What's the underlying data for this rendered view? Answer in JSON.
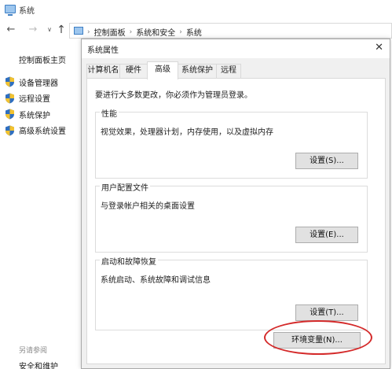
{
  "window": {
    "title": "系统"
  },
  "address": {
    "breadcrumbs": [
      "控制面板",
      "系统和安全",
      "系统"
    ]
  },
  "left_pane": {
    "home_link": "控制面板主页",
    "items": [
      {
        "label": "设备管理器",
        "icon": "shield-icon"
      },
      {
        "label": "远程设置",
        "icon": "shield-icon"
      },
      {
        "label": "系统保护",
        "icon": "shield-icon"
      },
      {
        "label": "高级系统设置",
        "icon": "shield-icon"
      }
    ],
    "see_also": "另请参阅",
    "security_link": "安全和维护"
  },
  "dialog": {
    "title": "系统属性",
    "close_glyph": "✕",
    "tabs": [
      "计算机名",
      "硬件",
      "高级",
      "系统保护",
      "远程"
    ],
    "active_tab": "高级",
    "admin_note": "要进行大多数更改，你必须作为管理员登录。",
    "groups": [
      {
        "title": "性能",
        "description": "视觉效果，处理器计划，内存使用，以及虚拟内存",
        "button": "设置(S)..."
      },
      {
        "title": "用户配置文件",
        "description": "与登录帐户相关的桌面设置",
        "button": "设置(E)..."
      },
      {
        "title": "启动和故障恢复",
        "description": "系统启动、系统故障和调试信息",
        "button": "设置(T)..."
      }
    ],
    "env_button": "环境变量(N)..."
  },
  "colors": {
    "highlight": "#d42a2a",
    "shield_blue": "#2f6fc0",
    "shield_yellow": "#f2c230"
  }
}
